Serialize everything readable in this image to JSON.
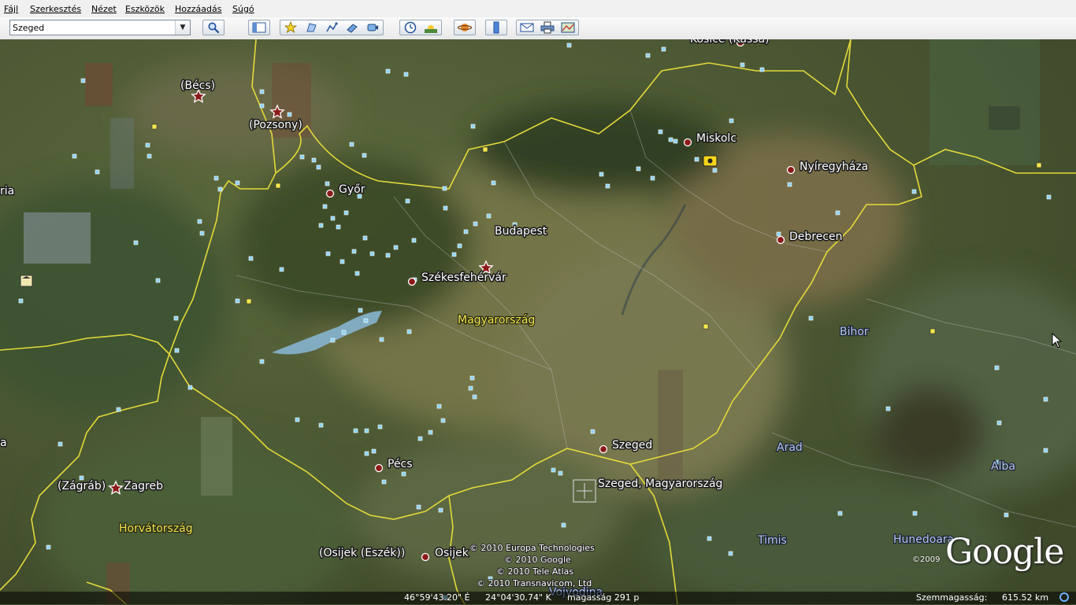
{
  "menu": {
    "items": [
      {
        "id": "file",
        "label": "Fájl"
      },
      {
        "id": "edit",
        "label": "Szerkesztés"
      },
      {
        "id": "view",
        "label": "Nézet"
      },
      {
        "id": "tools",
        "label": "Eszközök"
      },
      {
        "id": "add",
        "label": "Hozzáadás"
      },
      {
        "id": "help",
        "label": "Súgó"
      }
    ]
  },
  "toolbar": {
    "search_value": "Szeged",
    "icons": [
      "search-icon",
      "sidebar-icon",
      "placemark-icon",
      "polygon-icon",
      "path-icon",
      "image-overlay-icon",
      "record-tour-icon",
      "historical-imagery-icon",
      "sunlight-icon",
      "planets-icon",
      "ruler-icon",
      "email-icon",
      "print-icon",
      "view-in-maps-icon"
    ]
  },
  "map": {
    "cities": [
      {
        "name": "Budapest",
        "symbol": "star"
      },
      {
        "name": "Miskolc",
        "symbol": "dot"
      },
      {
        "name": "Nyíregyháza",
        "symbol": "dot"
      },
      {
        "name": "Debrecen",
        "symbol": "dot"
      },
      {
        "name": "Győr",
        "symbol": "dot"
      },
      {
        "name": "Székesfehérvár",
        "symbol": "dot"
      },
      {
        "name": "Pécs",
        "symbol": "dot"
      },
      {
        "name": "Szeged",
        "symbol": "dot"
      },
      {
        "name": "Osijek",
        "symbol": "dot"
      },
      {
        "name": "(Osijek (Eszék))",
        "symbol": "none"
      },
      {
        "name": "Zagreb",
        "symbol": "star"
      },
      {
        "name": "(Zágráb)",
        "symbol": "none"
      },
      {
        "name": "(Bécs)",
        "symbol": "star"
      },
      {
        "name": "(Pozsony)",
        "symbol": "star"
      },
      {
        "name": "Kosice (Kassa)",
        "symbol": "dot"
      }
    ],
    "countries": [
      "Magyarország",
      "Horvátország"
    ],
    "regions": [
      "Bihor",
      "Arad",
      "Alba",
      "Timis",
      "Hunedoara",
      "Vojvodina"
    ],
    "edge_labels": [
      "ria",
      "a"
    ],
    "search_result": "Szeged, Magyarország",
    "copyright": [
      "© 2010 Europa Technologies",
      "© 2010 Google",
      "© 2010 Tele Atlas",
      "© 2010 Transnavicom, Ltd"
    ],
    "logo": "Google",
    "logo_year": "©2009"
  },
  "status": {
    "lat": "46°59'43.20\" É",
    "lon": "24°04'30.74\" K",
    "elevation": "magasság  291 p",
    "eye_label": "Szemmagasság:",
    "eye_value": "615.52 km"
  }
}
